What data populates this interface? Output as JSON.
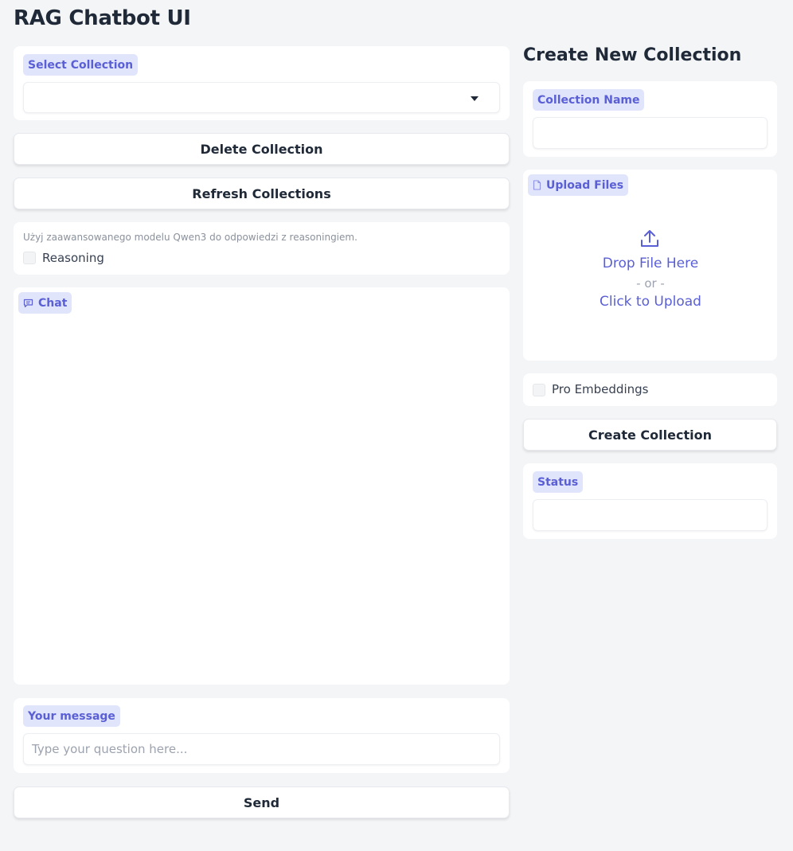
{
  "app": {
    "title": "RAG Chatbot UI"
  },
  "left": {
    "select_collection": {
      "label": "Select Collection",
      "value": ""
    },
    "delete_button": "Delete Collection",
    "refresh_button": "Refresh Collections",
    "reasoning": {
      "hint": "Użyj zaawansowanego modelu Qwen3 do odpowiedzi z reasoningiem.",
      "checkbox_label": "Reasoning",
      "checked": false
    },
    "chat": {
      "label": "Chat",
      "icon": "chat-icon"
    },
    "message": {
      "label": "Your message",
      "placeholder": "Type your question here...",
      "value": ""
    },
    "send_button": "Send"
  },
  "right": {
    "heading": "Create New Collection",
    "collection_name": {
      "label": "Collection Name",
      "value": ""
    },
    "upload": {
      "label": "Upload Files",
      "label_icon": "file-icon",
      "icon": "upload-icon",
      "drop_text": "Drop File Here",
      "or_text": "- or -",
      "click_text": "Click to Upload"
    },
    "pro_embeddings": {
      "label": "Pro Embeddings",
      "checked": false
    },
    "create_button": "Create Collection",
    "status": {
      "label": "Status",
      "value": ""
    }
  },
  "colors": {
    "accent": "#5a5fd6",
    "chip_bg": "#e0e5fb",
    "page_bg": "#f4f5f7"
  }
}
